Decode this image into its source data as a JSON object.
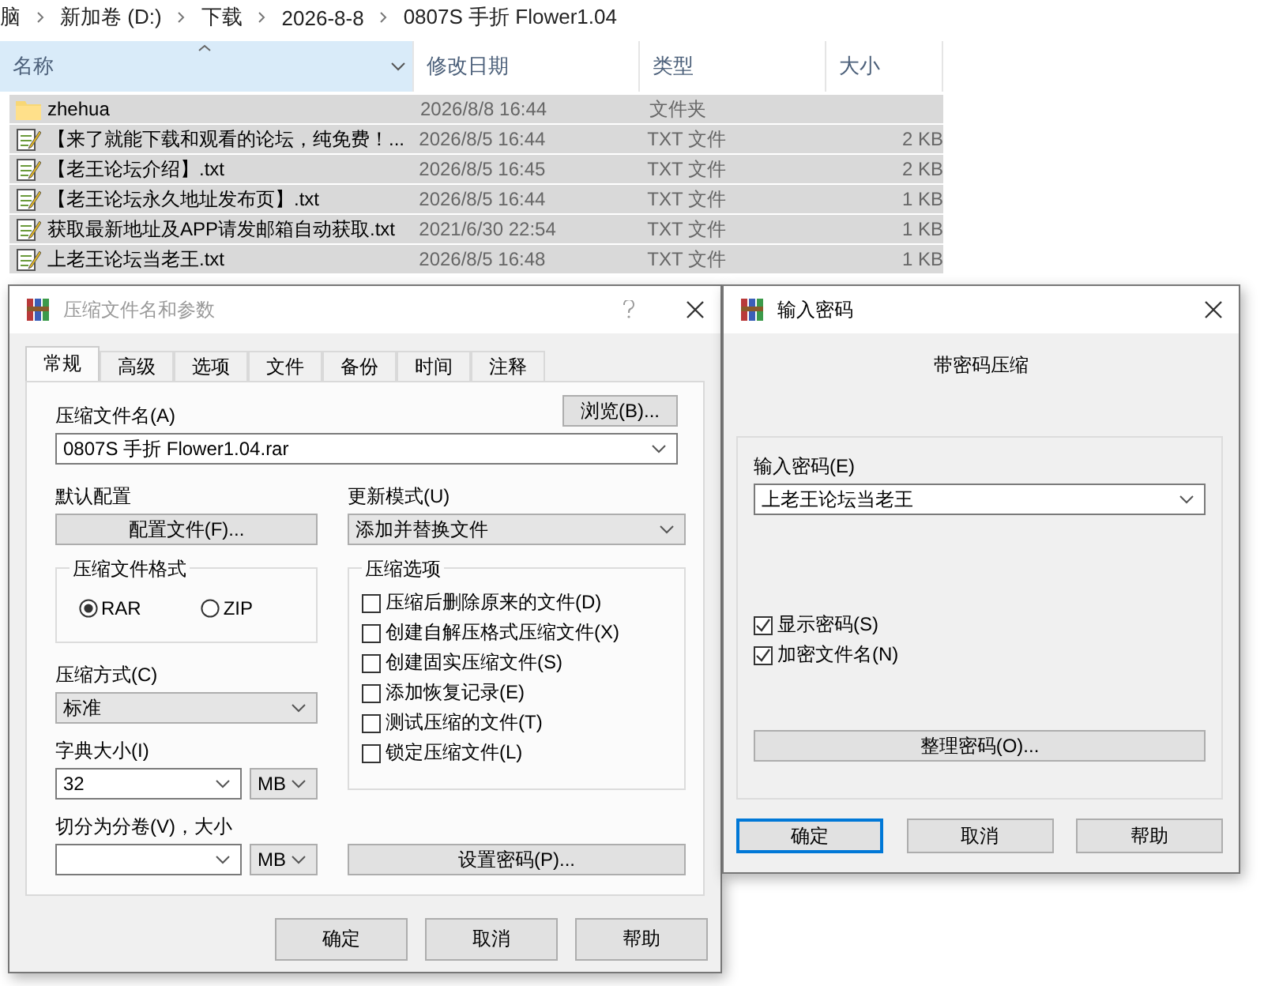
{
  "explorer": {
    "breadcrumb": [
      "脑",
      "新加卷 (D:)",
      "下载",
      "2026-8-8",
      "0807S 手折 Flower1.04"
    ],
    "columns": [
      {
        "label": "名称",
        "sorted": true
      },
      {
        "label": "修改日期",
        "sorted": false
      },
      {
        "label": "类型",
        "sorted": false
      },
      {
        "label": "大小",
        "sorted": false
      }
    ],
    "files": [
      {
        "kind": "folder",
        "name": "zhehua",
        "date": "2026/8/8 16:44",
        "type": "文件夹",
        "selected": true
      },
      {
        "kind": "text",
        "name": "【来了就能下载和观看的论坛，纯免费！...",
        "date": "2026/8/5 16:44",
        "type": "TXT 文件",
        "size": "2 KB",
        "selected": true
      },
      {
        "kind": "text",
        "name": "【老王论坛介绍】.txt",
        "date": "2026/8/5 16:45",
        "type": "TXT 文件",
        "size": "2 KB",
        "selected": true
      },
      {
        "kind": "text",
        "name": "【老王论坛永久地址发布页】.txt",
        "date": "2026/8/5 16:44",
        "type": "TXT 文件",
        "size": "1 KB",
        "selected": true
      },
      {
        "kind": "text",
        "name": "获取最新地址及APP请发邮箱自动获取.txt",
        "date": "2021/6/30 22:54",
        "type": "TXT 文件",
        "size": "1 KB",
        "selected": true
      },
      {
        "kind": "text",
        "name": "上老王论坛当老王.txt",
        "date": "2026/8/5 16:48",
        "type": "TXT 文件",
        "size": "1 KB",
        "selected": true
      }
    ]
  },
  "archive_dialog": {
    "title": "压缩文件名和参数",
    "active": false,
    "tabs": [
      {
        "label": "常规",
        "selected": true
      },
      {
        "label": "高级",
        "selected": false
      },
      {
        "label": "选项",
        "selected": false
      },
      {
        "label": "文件",
        "selected": false
      },
      {
        "label": "备份",
        "selected": false
      },
      {
        "label": "时间",
        "selected": false
      },
      {
        "label": "注释",
        "selected": false
      }
    ],
    "archive_name": {
      "label": "压缩文件名(A)",
      "value": "0807S 手折 Flower1.04.rar"
    },
    "browse_button": "浏览(B)...",
    "profile": {
      "label": "默认配置",
      "button": "配置文件(F)..."
    },
    "update_mode": {
      "label": "更新模式(U)",
      "value": "添加并替换文件"
    },
    "format": {
      "label": "压缩文件格式",
      "options": [
        {
          "label": "RAR",
          "selected": true
        },
        {
          "label": "ZIP",
          "selected": false
        }
      ]
    },
    "method": {
      "label": "压缩方式(C)",
      "value": "标准"
    },
    "dictionary": {
      "label": "字典大小(I)",
      "value": "32",
      "unit": "MB"
    },
    "split": {
      "label": "切分为分卷(V)，大小",
      "unit": "MB"
    },
    "options": {
      "label": "压缩选项",
      "items": [
        {
          "label": "压缩后删除原来的文件(D)",
          "checked": false
        },
        {
          "label": "创建自解压格式压缩文件(X)",
          "checked": false
        },
        {
          "label": "创建固实压缩文件(S)",
          "checked": false
        },
        {
          "label": "添加恢复记录(E)",
          "checked": false
        },
        {
          "label": "测试压缩的文件(T)",
          "checked": false
        },
        {
          "label": "锁定压缩文件(L)",
          "checked": false
        }
      ]
    },
    "password_button": "设置密码(P)...",
    "buttons": [
      "确定",
      "取消",
      "帮助"
    ]
  },
  "password_dialog": {
    "title": "输入密码",
    "active": true,
    "heading": "带密码压缩",
    "password": {
      "label": "输入密码(E)",
      "value": "上老王论坛当老王"
    },
    "options": [
      {
        "label": "显示密码(S)",
        "checked": true
      },
      {
        "label": "加密文件名(N)",
        "checked": true
      }
    ],
    "organize_button": "整理密码(O)...",
    "buttons": [
      {
        "label": "确定",
        "default": true
      },
      {
        "label": "取消",
        "default": false
      },
      {
        "label": "帮助",
        "default": false
      }
    ]
  }
}
